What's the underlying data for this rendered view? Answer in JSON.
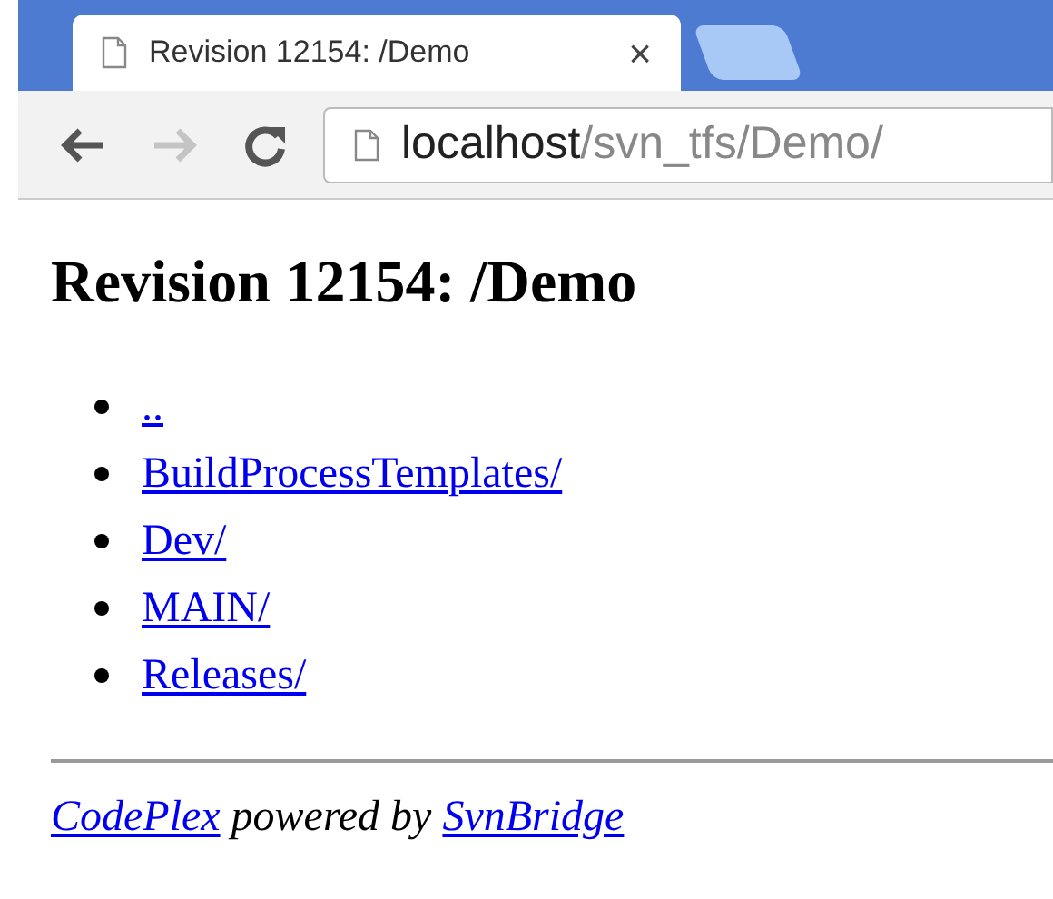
{
  "tab": {
    "title": "Revision 12154: /Demo",
    "close": "×"
  },
  "toolbar": {
    "back": {
      "disabled": false
    },
    "forward": {
      "disabled": true
    }
  },
  "address": {
    "host": "localhost",
    "path": "/svn_tfs/Demo/"
  },
  "page": {
    "heading": "Revision 12154: /Demo",
    "links": [
      {
        "label": ".."
      },
      {
        "label": "BuildProcessTemplates/"
      },
      {
        "label": "Dev/"
      },
      {
        "label": "MAIN/"
      },
      {
        "label": "Releases/"
      }
    ],
    "footer": {
      "link1": "CodePlex",
      "text": "powered by",
      "link2": "SvnBridge"
    }
  }
}
